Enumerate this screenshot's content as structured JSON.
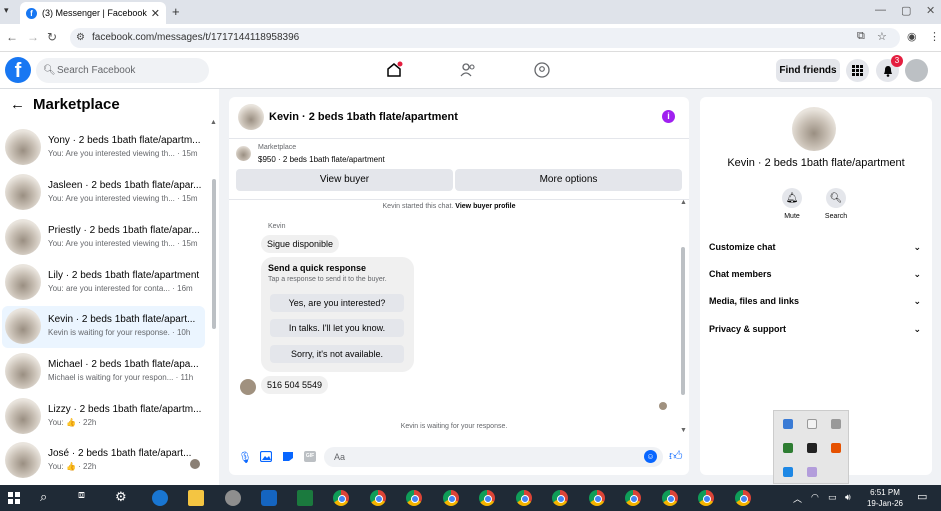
{
  "browser": {
    "tab_title": "(3) Messenger | Facebook",
    "tab_close": "✕",
    "new_tab": "+",
    "url": "facebook.com/messages/t/1717144118958396",
    "win_min": "—",
    "win_max": "▢",
    "win_close": "✕"
  },
  "fb": {
    "logo": "f",
    "search_placeholder": "Search Facebook",
    "find_friends": "Find friends",
    "notif_count": "3"
  },
  "left": {
    "title": "Marketplace",
    "conversations": [
      {
        "name": "Yony · 2 beds 1bath flate/apartm...",
        "snippet": "You: Are you interested viewing th... · 15m"
      },
      {
        "name": "Jasleen · 2 beds 1bath flate/apar...",
        "snippet": "You: Are you interested viewing th... · 15m"
      },
      {
        "name": "Priestly · 2 beds 1bath flate/apar...",
        "snippet": "You: Are you interested viewing th... · 15m"
      },
      {
        "name": "Lily · 2 beds 1bath flate/apartment",
        "snippet": "You: are you interested for conta... · 16m"
      },
      {
        "name": "Kevin · 2 beds 1bath flate/apart...",
        "snippet": "Kevin is waiting for your response. · 10h"
      },
      {
        "name": "Michael · 2 beds 1bath flate/apa...",
        "snippet": "Michael is waiting for your respon... · 11h"
      },
      {
        "name": "Lizzy · 2 beds 1bath flate/apartm...",
        "snippet": "You: 👍 · 22h"
      },
      {
        "name": "José · 2 beds 1bath flate/apart...",
        "snippet": "You: 👍 · 22h"
      }
    ]
  },
  "chat": {
    "title": "Kevin · 2 beds 1bath flate/apartment",
    "info_icon": "i",
    "marketplace_label": "Marketplace",
    "listing": "$950 · 2 beds 1bath flate/apartment",
    "view_buyer": "View buyer",
    "more_options": "More options",
    "started_text": "Kevin started this chat.",
    "view_buyer_profile": "View buyer profile",
    "sender": "Kevin",
    "msg1": "Sigue disponible",
    "quick_title": "Send a quick response",
    "quick_sub": "Tap a response to send it to the buyer.",
    "quick_options": [
      "Yes, are you interested?",
      "In talks. I'll let you know.",
      "Sorry, it's not available."
    ],
    "msg2": "516 504 5549",
    "waiting": "Kevin is waiting for your response.",
    "input_placeholder": "Aa",
    "gif": "GIF"
  },
  "right": {
    "name": "Kevin · 2 beds 1bath flate/apartment",
    "mute": "Mute",
    "search": "Search",
    "rows": [
      "Customize chat",
      "Chat members",
      "Media, files and links",
      "Privacy & support"
    ]
  },
  "taskbar": {
    "time": "6:51 PM",
    "date": "19-Jan-26"
  },
  "colors": {
    "fb_blue": "#1877f2",
    "messenger_blue": "#0866ff",
    "active_row": "#ebf5ff",
    "badge_red": "#e41e3f",
    "info_purple": "#a020f0",
    "taskbar": "#1f2a36"
  }
}
